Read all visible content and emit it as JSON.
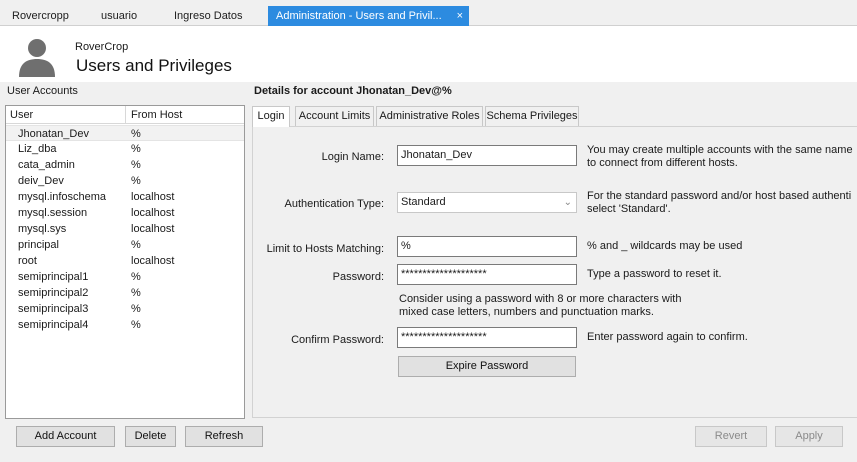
{
  "tabs": [
    {
      "label": "Rovercropp"
    },
    {
      "label": "usuario"
    },
    {
      "label": "Ingreso Datos"
    },
    {
      "label": "Administration - Users and Privil...",
      "active": true,
      "close": "×"
    }
  ],
  "header": {
    "connection": "RoverCrop",
    "title": "Users and Privileges",
    "icon": "user-silhouette-icon"
  },
  "user_accounts": {
    "label": "User Accounts",
    "columns": [
      "User",
      "From Host"
    ],
    "rows": [
      {
        "user": "Jhonatan_Dev",
        "host": "%"
      },
      {
        "user": "Liz_dba",
        "host": "%"
      },
      {
        "user": "cata_admin",
        "host": "%"
      },
      {
        "user": "deiv_Dev",
        "host": "%"
      },
      {
        "user": "mysql.infoschema",
        "host": "localhost"
      },
      {
        "user": "mysql.session",
        "host": "localhost"
      },
      {
        "user": "mysql.sys",
        "host": "localhost"
      },
      {
        "user": "principal",
        "host": "%"
      },
      {
        "user": "root",
        "host": "localhost"
      },
      {
        "user": "semiprincipal1",
        "host": "%"
      },
      {
        "user": "semiprincipal2",
        "host": "%"
      },
      {
        "user": "semiprincipal3",
        "host": "%"
      },
      {
        "user": "semiprincipal4",
        "host": "%"
      }
    ],
    "selected_index": 0
  },
  "buttons": {
    "add_account": "Add Account",
    "delete": "Delete",
    "refresh": "Refresh",
    "revert": "Revert",
    "apply": "Apply"
  },
  "details": {
    "title": "Details for account Jhonatan_Dev@%",
    "tabs": [
      "Login",
      "Account Limits",
      "Administrative Roles",
      "Schema Privileges"
    ],
    "active_tab": "Login",
    "login_name": {
      "label": "Login Name:",
      "value": "Jhonatan_Dev",
      "help1": "You may create multiple accounts with the same name",
      "help2": "to connect from different hosts."
    },
    "auth_type": {
      "label": "Authentication Type:",
      "value": "Standard",
      "help1": "For the standard password and/or host based authenti",
      "help2": "select 'Standard'."
    },
    "hosts": {
      "label": "Limit to Hosts Matching:",
      "value": "%",
      "help": "% and _ wildcards may be used"
    },
    "password": {
      "label": "Password:",
      "value": "********************",
      "help": "Type a password to reset it."
    },
    "password_hint1": "Consider using a password with 8 or more characters with",
    "password_hint2": "mixed case letters, numbers and punctuation marks.",
    "confirm": {
      "label": "Confirm Password:",
      "value": "********************",
      "help": "Enter password again to confirm."
    },
    "expire_button": "Expire Password"
  }
}
